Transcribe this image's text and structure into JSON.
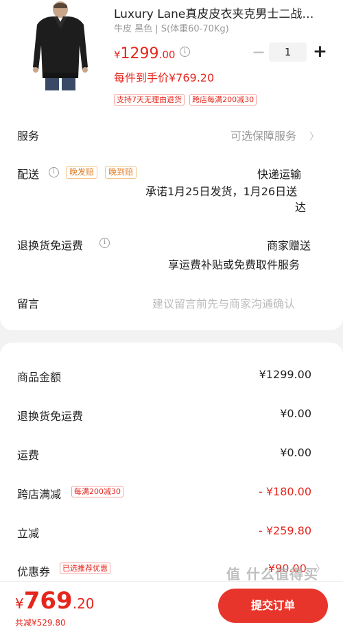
{
  "product": {
    "title": "Luxury Lane真皮皮衣夹克男士二战…",
    "spec": "牛皮 黑色 | S(体重60-70Kg)",
    "price_currency": "¥",
    "price_int": "1299",
    "price_dec": ".00",
    "qty": "1",
    "hand_price": "每件到手价¥769.20",
    "tags": [
      "支持7天无理由退货",
      "跨店每满200减30"
    ],
    "image_icon": "leather-jacket-photo"
  },
  "service": {
    "label": "服务",
    "value": "可选保障服务",
    "chevron": "〉"
  },
  "delivery": {
    "label": "配送",
    "tags": [
      "晚发赔",
      "晚到赔"
    ],
    "method": "快递运输",
    "promise_line1": "承诺1月25日发货，1月26日送",
    "promise_line2": "达"
  },
  "return_shipping": {
    "label": "退换货免运费",
    "value1": "商家赠送",
    "value2": "享运费补贴或免费取件服务"
  },
  "message": {
    "label": "留言",
    "placeholder": "建议留言前先与商家沟通确认"
  },
  "summary": {
    "rows": [
      {
        "label": "商品金额",
        "value": "¥1299.00"
      },
      {
        "label": "退换货免运费",
        "value": "¥0.00"
      },
      {
        "label": "运费",
        "value": "¥0.00"
      },
      {
        "label": "跨店满减",
        "tag": "每满200减30",
        "value": "- ¥180.00"
      },
      {
        "label": "立减",
        "value": "- ¥259.80"
      },
      {
        "label": "优惠券",
        "tag": "已选推荐优惠",
        "value": "-¥90.00"
      }
    ]
  },
  "bottom": {
    "currency": "¥",
    "total_int": "769",
    "total_dec": ".20",
    "saved": "共减¥529.80",
    "submit_label": "提交订单",
    "watermark": "值 什么值得买"
  },
  "colors": {
    "accent": "#e5261d",
    "submit": "#e8352b",
    "muted": "#999999"
  }
}
